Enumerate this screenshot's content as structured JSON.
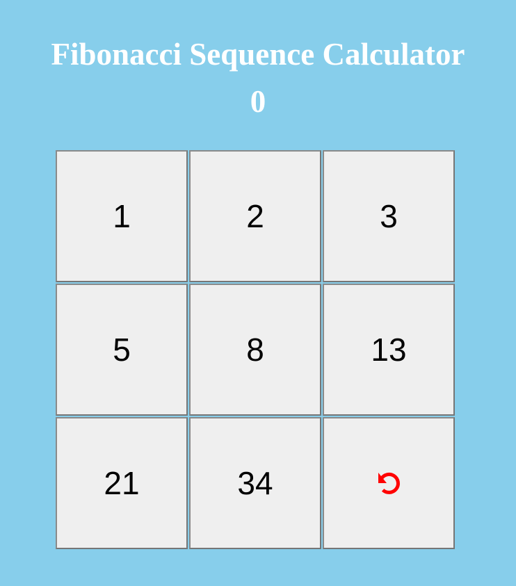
{
  "app": {
    "title": "Fibonacci Sequence Calculator"
  },
  "display": {
    "value": "0"
  },
  "keypad": {
    "keys": [
      "1",
      "2",
      "3",
      "5",
      "8",
      "13",
      "21",
      "34"
    ],
    "reset_icon": "undo-icon"
  },
  "colors": {
    "background": "#87ceeb",
    "text": "#ffffff",
    "button_bg": "#efefef",
    "reset_icon": "#ff0000"
  }
}
